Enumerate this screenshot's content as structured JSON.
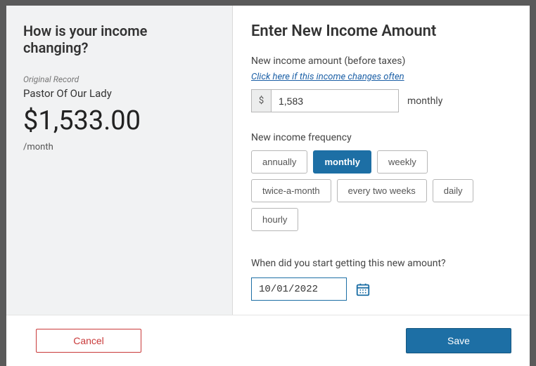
{
  "left": {
    "heading": "How is your income changing?",
    "original_label": "Original Record",
    "source": "Pastor Of Our Lady",
    "amount": "$1,533.00",
    "frequency": "/month"
  },
  "right": {
    "heading": "Enter New Income Amount",
    "amount_label": "New income amount (before taxes)",
    "help_link": "Click here if this income changes often",
    "currency_symbol": "$",
    "amount_value": "1,583",
    "per_text": "monthly",
    "freq_label": "New income frequency",
    "freq_options": {
      "annually": "annually",
      "monthly": "monthly",
      "weekly": "weekly",
      "twice_a_month": "twice-a-month",
      "every_two_weeks": "every two weeks",
      "daily": "daily",
      "hourly": "hourly"
    },
    "freq_selected": "monthly",
    "date_label": "When did you start getting this new amount?",
    "date_value": "10/01/2022"
  },
  "footer": {
    "cancel": "Cancel",
    "save": "Save"
  }
}
